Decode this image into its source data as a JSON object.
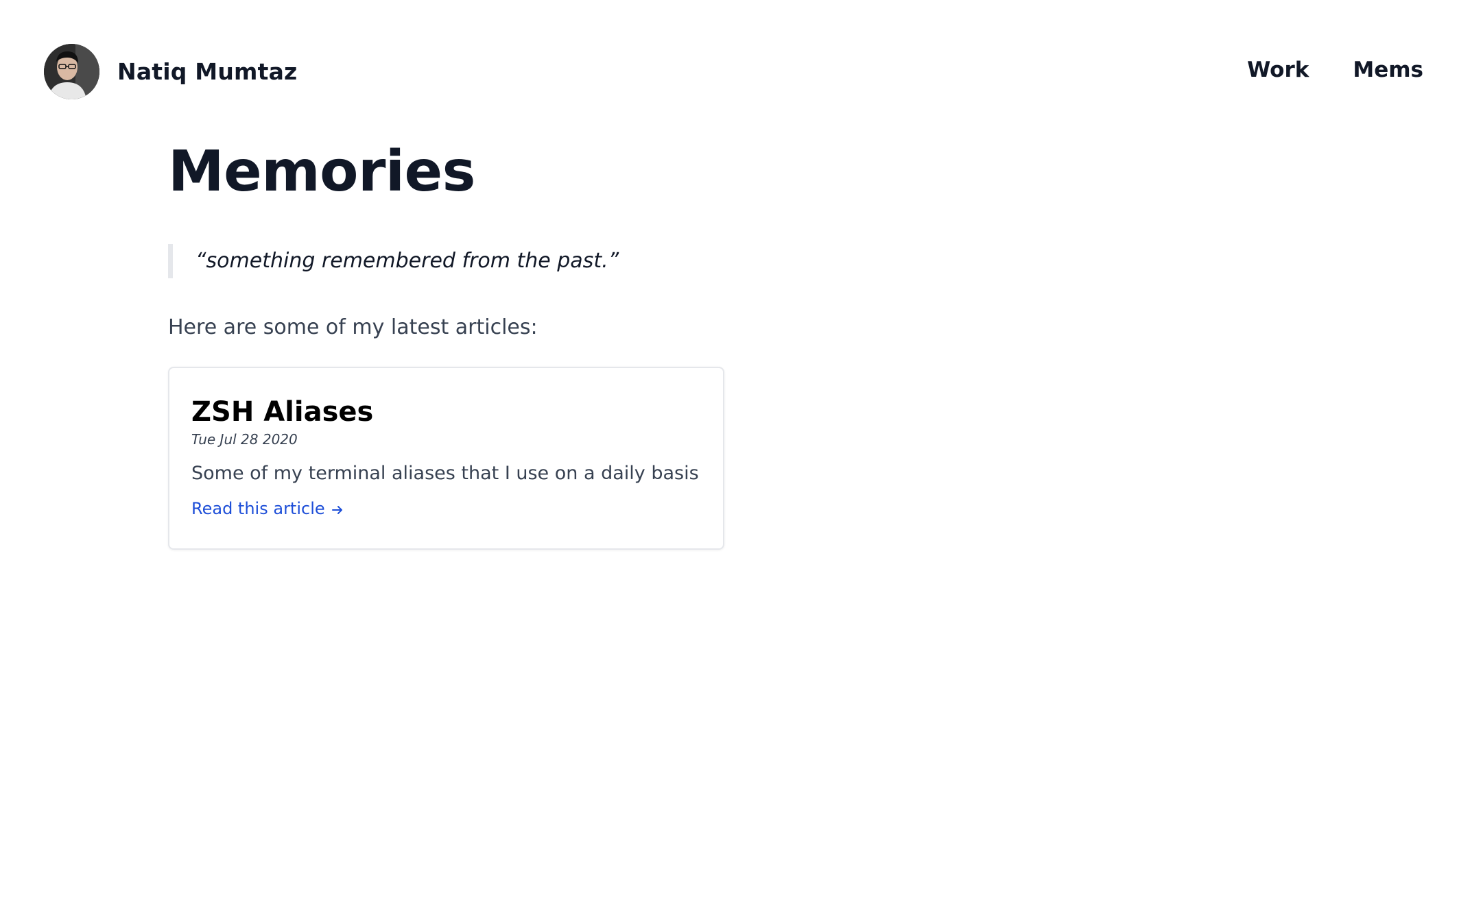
{
  "header": {
    "brand_name": "Natiq Mumtaz",
    "nav": [
      {
        "label": "Work"
      },
      {
        "label": "Mems"
      }
    ]
  },
  "main": {
    "title": "Memories",
    "quote": "“something remembered from the past.”",
    "intro": "Here are some of my latest articles:",
    "articles": [
      {
        "title": "ZSH Aliases",
        "date": "Tue Jul 28 2020",
        "description": "Some of my terminal aliases that I use on a daily basis",
        "link_label": "Read this article"
      }
    ]
  },
  "colors": {
    "text_dark": "#111827",
    "text_muted": "#374151",
    "link_blue": "#1d4ed8",
    "border": "#e5e7eb"
  },
  "icons": {
    "avatar": "profile-photo",
    "link_arrow": "arrow-right-icon"
  }
}
